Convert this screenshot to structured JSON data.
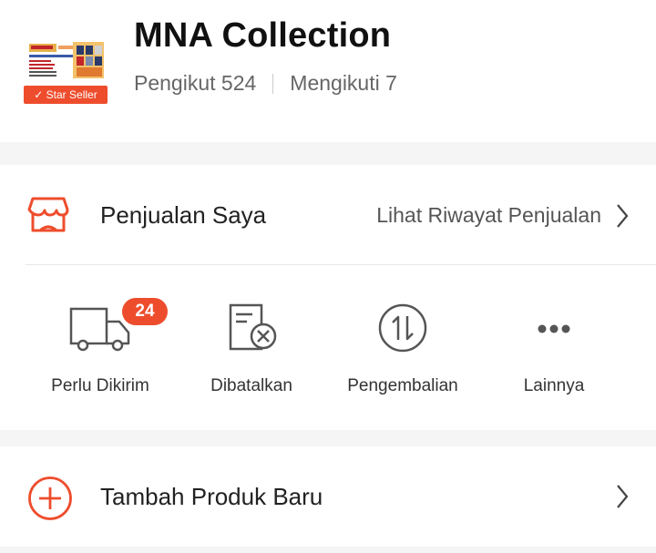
{
  "profile": {
    "shop_name": "MNA Collection",
    "badge": "✓ Star Seller",
    "followers": "Pengikut 524",
    "following": "Mengikuti 7"
  },
  "sales": {
    "title": "Penjualan Saya",
    "link": "Lihat Riwayat Penjualan",
    "items": [
      {
        "label": "Perlu Dikirim",
        "icon": "truck-icon",
        "badge": "24"
      },
      {
        "label": "Dibatalkan",
        "icon": "cancelled-document-icon"
      },
      {
        "label": "Pengembalian",
        "icon": "return-arrows-icon"
      },
      {
        "label": "Lainnya",
        "icon": "more-dots-icon"
      }
    ]
  },
  "add_product": {
    "title": "Tambah Produk Baru"
  },
  "colors": {
    "accent": "#ee4d2d",
    "icon_gray": "#555555"
  }
}
